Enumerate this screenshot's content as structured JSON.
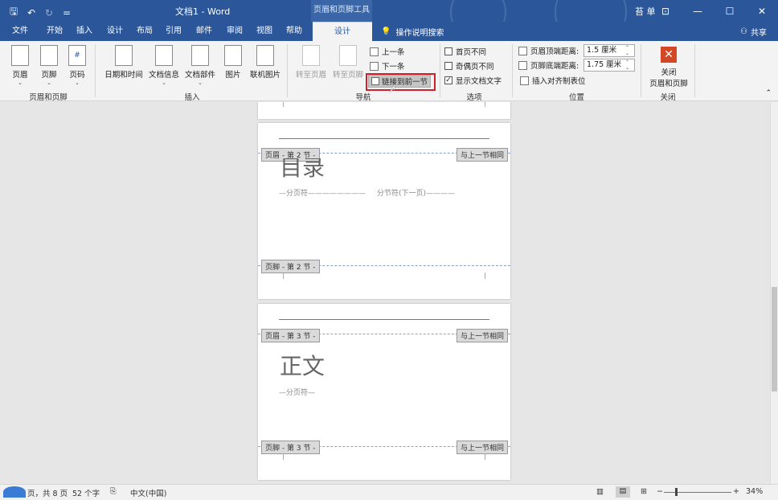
{
  "title_bar": {
    "doc_title": "文档1 - Word",
    "context_tool": "页眉和页脚工具",
    "user_name": "苔 单",
    "qat": {
      "save": "🖫",
      "undo": "↶",
      "redo": "↻",
      "customize": "="
    }
  },
  "tabs": [
    {
      "label": "文件",
      "x": 0
    },
    {
      "label": "开始"
    },
    {
      "label": "插入"
    },
    {
      "label": "设计"
    },
    {
      "label": "布局"
    },
    {
      "label": "引用"
    },
    {
      "label": "邮件"
    },
    {
      "label": "审阅"
    },
    {
      "label": "视图"
    },
    {
      "label": "帮助"
    },
    {
      "label": "设计"
    }
  ],
  "tell_me": "操作说明搜索",
  "share": "共享",
  "ribbon": {
    "header_footer": {
      "label": "页眉和页脚",
      "header": "页眉",
      "footer": "页脚",
      "page_number": "页码"
    },
    "insert": {
      "label": "插入",
      "date_time": "日期和时间",
      "doc_info": "文档信息",
      "doc_parts": "文档部件",
      "picture": "图片",
      "online_picture": "联机图片"
    },
    "navigation": {
      "label": "导航",
      "goto_header": "转至页眉",
      "goto_footer": "转至页脚",
      "previous": "上一条",
      "next": "下一条",
      "link_previous": "链接到前一节"
    },
    "options": {
      "label": "选项",
      "different_first": "首页不同",
      "different_odd_even": "奇偶页不同",
      "show_doc_text": "显示文档文字"
    },
    "position": {
      "label": "位置",
      "header_top_label": "页眉顶端距离:",
      "header_top_value": "1.5 厘米",
      "footer_bottom_label": "页脚底端距离:",
      "footer_bottom_value": "1.75 厘米",
      "insert_align_tab": "插入对齐制表位"
    },
    "close": {
      "label": "关闭",
      "close_line1": "关闭",
      "close_line2": "页眉和页脚"
    }
  },
  "document": {
    "page2": {
      "header_tag": "页眉 - 第 2 节 -",
      "same_as_prev_header": "与上一节相同",
      "heading": "目录",
      "page_break": "分页符",
      "section_break": "分节符(下一页)",
      "footer_tag": "页脚 - 第 2 节 -"
    },
    "page3": {
      "header_tag": "页眉 - 第 3 节 -",
      "same_as_prev_header": "与上一节相同",
      "heading": "正文",
      "page_break": "分页符",
      "footer_tag": "页脚 - 第 3 节 -",
      "same_as_prev_footer": "与上一节相同"
    }
  },
  "status_bar": {
    "page_info": "页，共 8 页",
    "word_count": "52 个字",
    "language": "中文(中国)",
    "zoom": "34%"
  },
  "colors": {
    "title_bar": "#2b579a",
    "highlight": "#d0202e"
  }
}
